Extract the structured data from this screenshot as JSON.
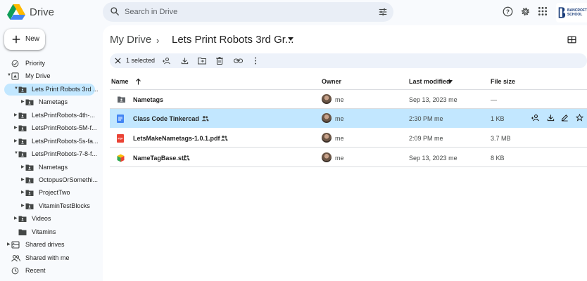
{
  "app": {
    "name": "Drive",
    "org_badge_lines": [
      "BANCROFT",
      "SCHOOL"
    ]
  },
  "search": {
    "placeholder": "Search in Drive"
  },
  "sidebar": {
    "new_label": "New",
    "items": [
      {
        "label": "Priority",
        "icon": "priority-icon"
      },
      {
        "label": "My Drive",
        "icon": "my-drive-icon"
      },
      {
        "label": "Lets Print Robots 3rd ...",
        "icon": "shared-folder-icon",
        "selected": true
      },
      {
        "label": "Nametags",
        "icon": "shared-folder-icon"
      },
      {
        "label": "LetsPrintRobots-4th-...",
        "icon": "shared-folder-icon"
      },
      {
        "label": "LetsPrintRobots-5M-f...",
        "icon": "shared-folder-icon"
      },
      {
        "label": "LetsPrintRobots-5s-fa...",
        "icon": "shared-folder-icon"
      },
      {
        "label": "LetsPrintRobots-7-8-f...",
        "icon": "shared-folder-icon"
      },
      {
        "label": "Nametags",
        "icon": "shared-folder-icon"
      },
      {
        "label": "OctopusOrSomethi...",
        "icon": "shared-folder-icon"
      },
      {
        "label": "ProjectTwo",
        "icon": "shared-folder-icon"
      },
      {
        "label": "VitaminTestBlocks",
        "icon": "shared-folder-icon"
      },
      {
        "label": "Videos",
        "icon": "shared-folder-icon"
      },
      {
        "label": "Vitamins",
        "icon": "folder-icon"
      },
      {
        "label": "Shared drives",
        "icon": "shared-drives-icon"
      },
      {
        "label": "Shared with me",
        "icon": "shared-with-me-icon"
      },
      {
        "label": "Recent",
        "icon": "recent-icon"
      }
    ]
  },
  "breadcrumb": {
    "root": "My Drive",
    "separator": "›",
    "current": "Lets Print Robots 3rd Gr..."
  },
  "action_bar": {
    "selected_text": "1 selected"
  },
  "columns": {
    "name": "Name",
    "owner": "Owner",
    "modified": "Last modified",
    "size": "File size"
  },
  "files": [
    {
      "name": "Nametags",
      "type": "shared-folder",
      "owner": "me",
      "modified": "Sep 13, 2023",
      "modified_by": "me",
      "size": "—",
      "shared": false,
      "selected": false
    },
    {
      "name": "Class Code Tinkercad",
      "type": "google-doc",
      "owner": "me",
      "modified": "2:30 PM",
      "modified_by": "me",
      "size": "1 KB",
      "shared": true,
      "selected": true
    },
    {
      "name": "LetsMakeNametags-1.0.1.pdf",
      "type": "pdf",
      "owner": "me",
      "modified": "2:09 PM",
      "modified_by": "me",
      "size": "3.7 MB",
      "shared": true,
      "selected": false
    },
    {
      "name": "NameTagBase.stl",
      "type": "stl",
      "owner": "me",
      "modified": "Sep 13, 2023",
      "modified_by": "me",
      "size": "8 KB",
      "shared": true,
      "selected": false
    }
  ],
  "colors": {
    "selected": "#c2e7ff",
    "surface": "#f8fafd",
    "doc_blue": "#4285f4",
    "pdf_red": "#ea4335"
  }
}
